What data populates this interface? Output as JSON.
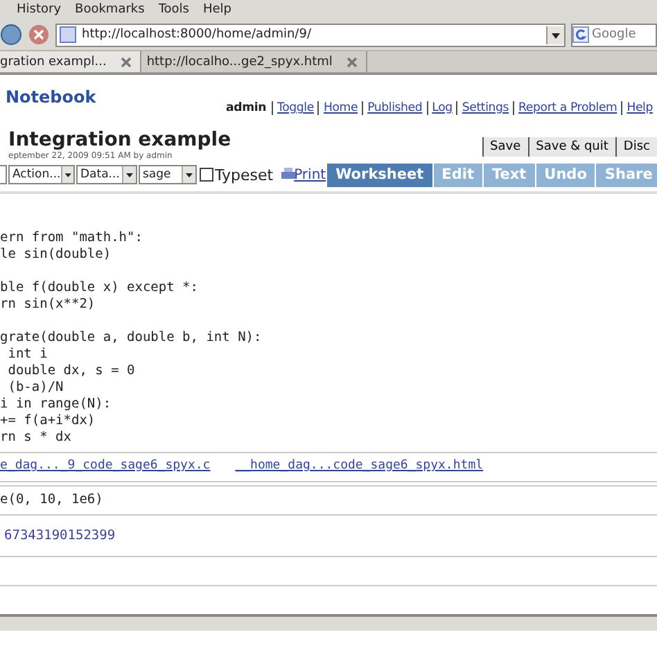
{
  "menu": [
    "History",
    "Bookmarks",
    "Tools",
    "Help"
  ],
  "address": "http://localhost:8000/home/admin/9/",
  "search": {
    "placeholder": "Google"
  },
  "tabs": [
    {
      "label": "gration exampl...",
      "selected": true
    },
    {
      "label": "http://localho...ge2_spyx.html",
      "selected": false
    }
  ],
  "header": {
    "brand": "Notebook",
    "user": "admin",
    "links": [
      "Toggle",
      "Home",
      "Published",
      "Log",
      "Settings",
      "Report a Problem",
      "Help"
    ]
  },
  "worksheet": {
    "title": "Integration example",
    "date": "eptember 22, 2009 09:51 AM by admin",
    "buttons": [
      "Save",
      "Save & quit",
      "Disc"
    ]
  },
  "toolbar": {
    "selects": [
      "Action...",
      "Data...",
      "sage"
    ],
    "typeset": {
      "label": "Typeset",
      "checked": false
    },
    "print": "Print",
    "modes": [
      {
        "label": "Worksheet",
        "selected": true
      },
      {
        "label": "Edit",
        "selected": false
      },
      {
        "label": "Text",
        "selected": false
      },
      {
        "label": "Undo",
        "selected": false
      },
      {
        "label": "Share",
        "selected": false
      }
    ]
  },
  "cells": [
    {
      "blocks": [
        [
          "ern from \"math.h\":",
          "le sin(double)"
        ],
        [
          "ble f(double x) except *:",
          "rn sin(x**2)"
        ],
        [
          "grate(double a, double b, int N):",
          " int i",
          " double dx, s = 0",
          " (b-a)/N",
          "i in range(N):",
          "+= f(a+i*dx)",
          "rn s * dx"
        ]
      ],
      "links": [
        "e_dag..._9_code_sage6_spyx.c",
        "__home_dag...code_sage6_spyx.html"
      ]
    },
    {
      "blocks": [
        [
          "e(0, 10, 1e6)"
        ]
      ],
      "output": "67343190152399"
    },
    {}
  ]
}
